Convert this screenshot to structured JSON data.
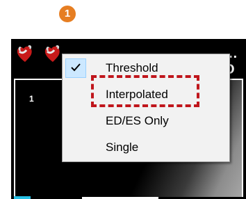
{
  "annotation": {
    "step_number": "1",
    "highlight_color": "#c0161c",
    "badge_color": "#e67e22"
  },
  "toolbar": {
    "icons": [
      "heart-icon",
      "heart-icon"
    ],
    "partial_text": "…O"
  },
  "viewer": {
    "frame_number": "1"
  },
  "context_menu": {
    "items": [
      {
        "label": "Threshold",
        "checked": true
      },
      {
        "label": "Interpolated",
        "checked": false,
        "highlighted": true
      },
      {
        "label": "ED/ES Only",
        "checked": false
      },
      {
        "label": "Single",
        "checked": false
      }
    ]
  }
}
